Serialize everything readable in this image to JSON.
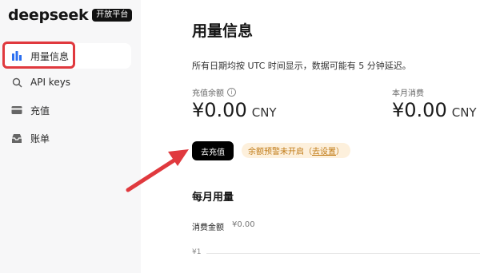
{
  "brand": {
    "name": "deepseek",
    "badge": "开放平台"
  },
  "sidebar": {
    "items": [
      {
        "label": "用量信息",
        "icon": "bar-chart-icon",
        "active": true
      },
      {
        "label": "API keys",
        "icon": "search-icon",
        "active": false
      },
      {
        "label": "充值",
        "icon": "credit-card-icon",
        "active": false
      },
      {
        "label": "账单",
        "icon": "inbox-icon",
        "active": false
      }
    ]
  },
  "main": {
    "title": "用量信息",
    "notice": "所有日期均按 UTC 时间显示，数据可能有 5 分钟延迟。",
    "balance": {
      "label": "充值余额",
      "amount": "¥0.00",
      "currency": "CNY"
    },
    "monthly": {
      "label": "本月消费",
      "amount": "¥0.00",
      "currency": "CNY"
    },
    "recharge_button": "去充值",
    "warning": {
      "text": "余额预警未开启",
      "link": "去设置"
    },
    "usage_section": {
      "title": "每月用量",
      "spend_label": "消费金额",
      "spend_value": "¥0.00",
      "axis_label": "¥1"
    }
  },
  "colors": {
    "highlight": "#e0393e",
    "warning_bg": "#fdf0dc",
    "warning_text": "#c07a15",
    "arrow": "#e0393e"
  }
}
